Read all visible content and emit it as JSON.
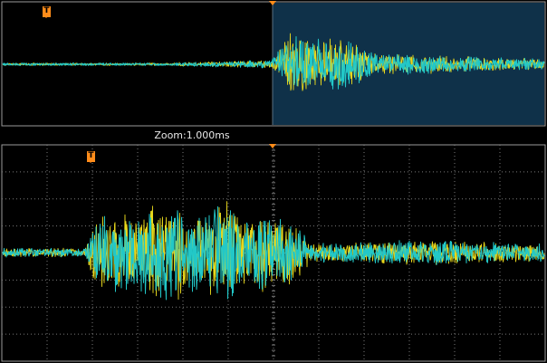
{
  "zoom": {
    "label": "Zoom:1.000ms"
  },
  "trigger": {
    "marker_text": "T"
  },
  "colors": {
    "trace_primary": "#22c8c8",
    "trace_secondary": "#e8d81c",
    "zoom_window": "#0f3149",
    "grid": "#7a7a7a",
    "trigger_marker": "#ff8c1a",
    "border": "#9a9a9a"
  }
}
